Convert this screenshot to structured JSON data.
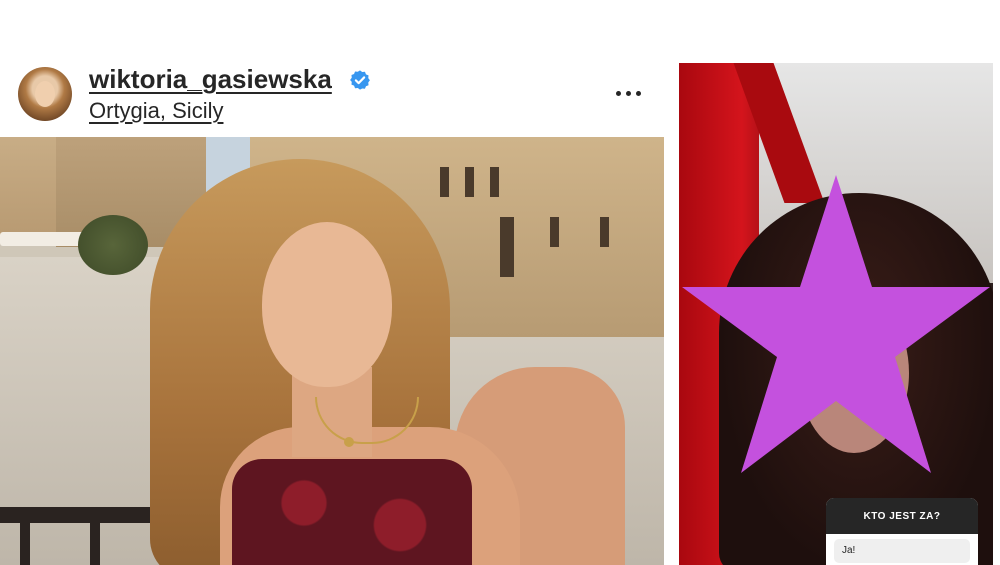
{
  "post": {
    "username": "wiktoria_gasiewska",
    "verified": true,
    "location": "Ortygia, Sicily",
    "more_icon": "more-horizontal-icon",
    "photo_description_icon": "post-photo"
  },
  "story": {
    "sticker_icon": "star-sticker",
    "question_box": {
      "title": "KTO JEST ZA?",
      "answer": "Ja!"
    }
  },
  "colors": {
    "text": "#262626",
    "verified_badge": "#3897f0",
    "star_sticker": "#c451de",
    "question_header": "#262626"
  }
}
